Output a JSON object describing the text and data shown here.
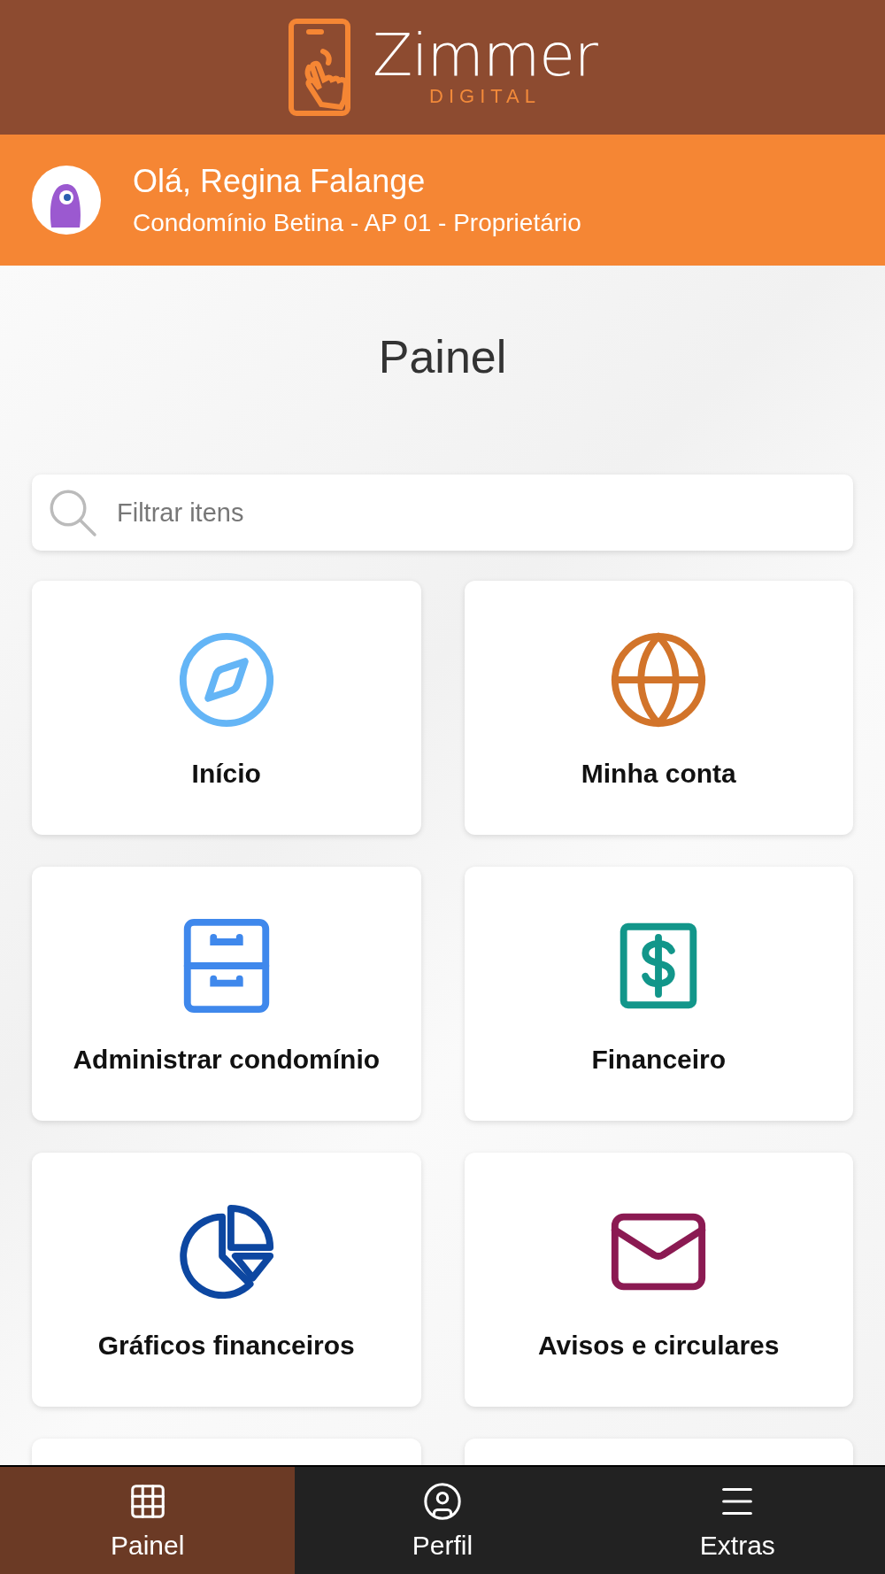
{
  "logo": {
    "name": "Zimmer",
    "tagline": "DIGITAL"
  },
  "greeting": {
    "title": "Olá, Regina Falange",
    "subtitle": "Condomínio Betina - AP 01 - Proprietário"
  },
  "page_title": "Painel",
  "search": {
    "placeholder": "Filtrar itens"
  },
  "cards": [
    {
      "label": "Início",
      "color": "#64b5f6"
    },
    {
      "label": "Minha conta",
      "color": "#d2742a"
    },
    {
      "label": "Administrar condomínio",
      "color": "#3f88ec"
    },
    {
      "label": "Financeiro",
      "color": "#12968a"
    },
    {
      "label": "Gráficos financeiros",
      "color": "#0d47a1"
    },
    {
      "label": "Avisos e circulares",
      "color": "#8b1a52"
    }
  ],
  "nav": [
    {
      "label": "Painel",
      "selected": true
    },
    {
      "label": "Perfil",
      "selected": false
    },
    {
      "label": "Extras",
      "selected": false
    }
  ]
}
